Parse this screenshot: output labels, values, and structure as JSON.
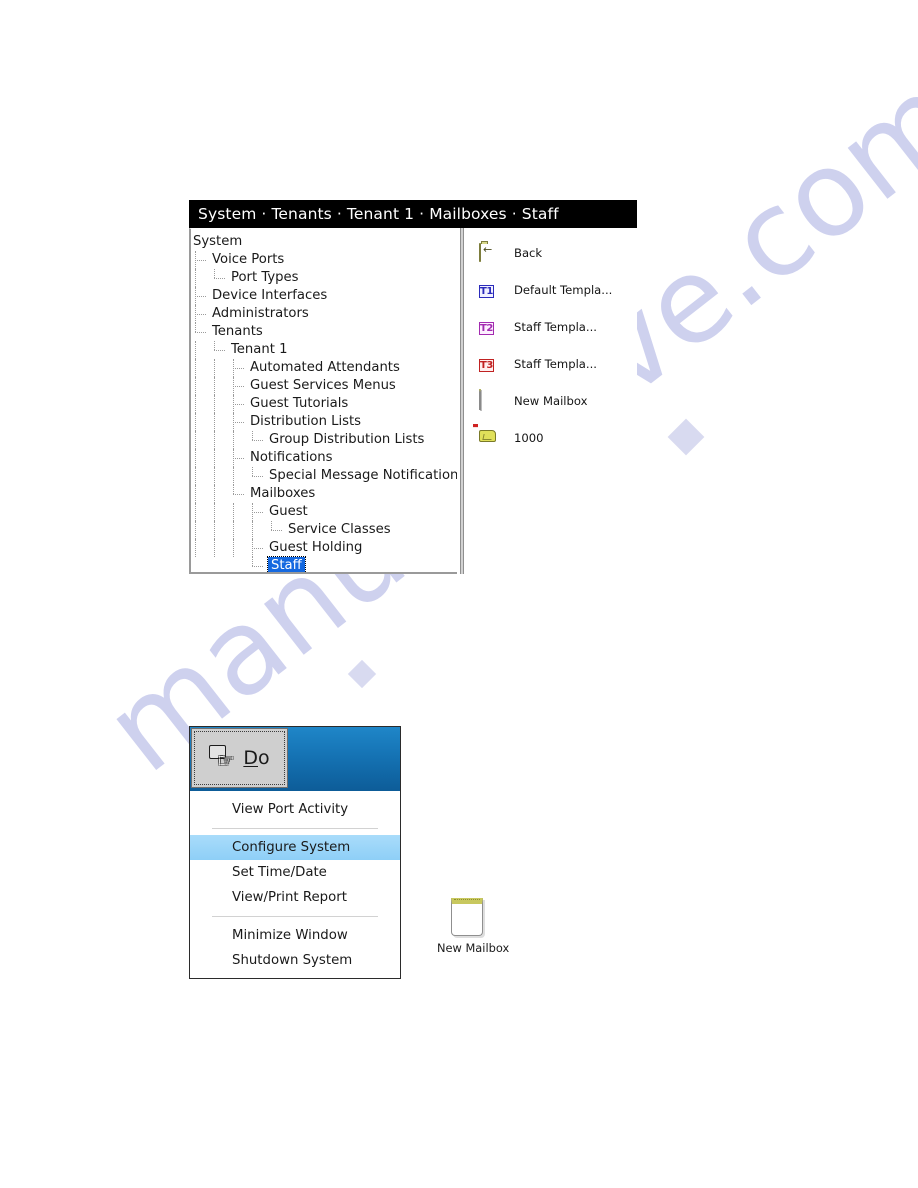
{
  "watermark": {
    "text": "manualshive.com"
  },
  "configurator": {
    "titlebar": "System · Tenants · Tenant 1 · Mailboxes · Staff",
    "tree": [
      {
        "label": "System",
        "depth": 0,
        "selected": false
      },
      {
        "label": "Voice Ports",
        "depth": 1,
        "selected": false
      },
      {
        "label": "Port Types",
        "depth": 2,
        "selected": false
      },
      {
        "label": "Device Interfaces",
        "depth": 1,
        "selected": false
      },
      {
        "label": "Administrators",
        "depth": 1,
        "selected": false
      },
      {
        "label": "Tenants",
        "depth": 1,
        "selected": false
      },
      {
        "label": "Tenant 1",
        "depth": 2,
        "selected": false
      },
      {
        "label": "Automated Attendants",
        "depth": 3,
        "selected": false
      },
      {
        "label": "Guest Services Menus",
        "depth": 3,
        "selected": false
      },
      {
        "label": "Guest Tutorials",
        "depth": 3,
        "selected": false
      },
      {
        "label": "Distribution Lists",
        "depth": 3,
        "selected": false
      },
      {
        "label": "Group Distribution Lists",
        "depth": 4,
        "selected": false
      },
      {
        "label": "Notifications",
        "depth": 3,
        "selected": false
      },
      {
        "label": "Special Message Notifications",
        "depth": 4,
        "selected": false
      },
      {
        "label": "Mailboxes",
        "depth": 3,
        "selected": false
      },
      {
        "label": "Guest",
        "depth": 4,
        "selected": false
      },
      {
        "label": "Service Classes",
        "depth": 5,
        "selected": false
      },
      {
        "label": "Guest Holding",
        "depth": 4,
        "selected": false
      },
      {
        "label": "Staff",
        "depth": 4,
        "selected": true
      }
    ],
    "items": [
      {
        "label": "Back",
        "icon": "back-folder-icon"
      },
      {
        "label": "Default Templa...",
        "icon": "template-t1-icon"
      },
      {
        "label": "Staff Templa...",
        "icon": "template-t2-icon"
      },
      {
        "label": "Staff Templa...",
        "icon": "template-t3-icon"
      },
      {
        "label": "New Mailbox",
        "icon": "new-mailbox-icon"
      },
      {
        "label": "1000",
        "icon": "mailbox-icon"
      }
    ]
  },
  "do_menu": {
    "button_label": "Do",
    "button_accel": "D",
    "button_rest": "o",
    "items": [
      {
        "label": "View Port Activity",
        "highlighted": false,
        "separator_after": true
      },
      {
        "label": "Configure System",
        "highlighted": true,
        "separator_after": false
      },
      {
        "label": "Set Time/Date",
        "highlighted": false,
        "separator_after": false
      },
      {
        "label": "View/Print Report",
        "highlighted": false,
        "separator_after": true
      },
      {
        "label": "Minimize Window",
        "highlighted": false,
        "separator_after": false
      },
      {
        "label": "Shutdown System",
        "highlighted": false,
        "separator_after": false
      }
    ]
  },
  "new_mailbox_figure": {
    "caption": "New Mailbox"
  },
  "colors": {
    "titlebar_bg": "#000000",
    "selection_blue": "#1569e0",
    "menu_highlight": "#8ecff7",
    "do_header_blue": "#1573b4",
    "watermark": "#c6c9ec"
  }
}
